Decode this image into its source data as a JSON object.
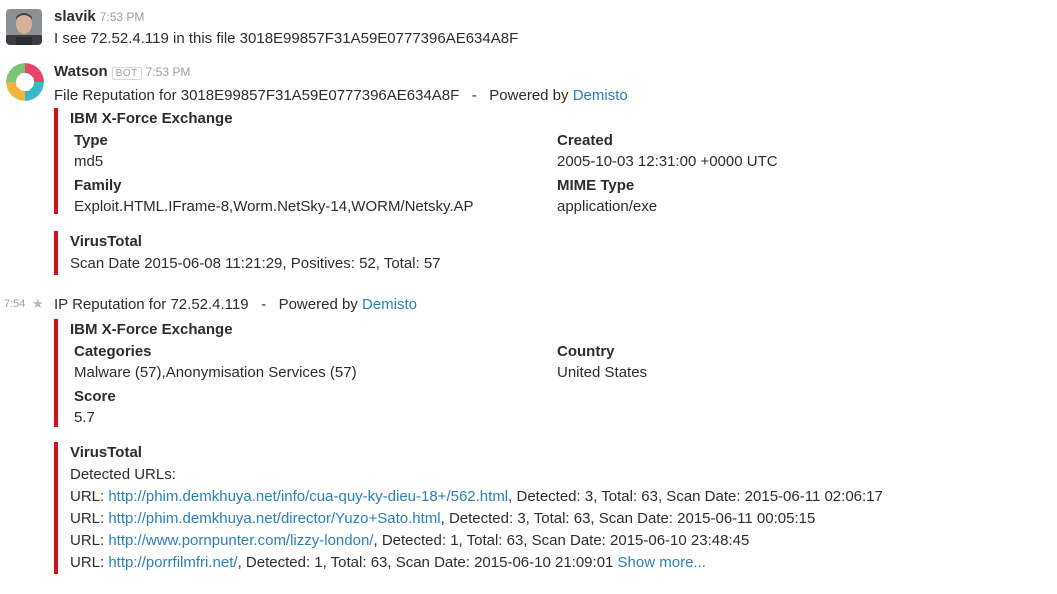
{
  "message1": {
    "username": "slavik",
    "time": "7:53 PM",
    "text": "I see 72.52.4.119 in this file 3018E99857F31A59E0777396AE634A8F"
  },
  "message2": {
    "username": "Watson",
    "bot_badge": "BOT",
    "time": "7:53 PM",
    "header_text": "File Reputation for 3018E99857F31A59E0777396AE634A8F   -   Powered by ",
    "powered_link": "Demisto",
    "xforce": {
      "title": "IBM X-Force Exchange",
      "type_label": "Type",
      "type_value": "md5",
      "created_label": "Created",
      "created_value": "2005-10-03 12:31:00 +0000 UTC",
      "family_label": "Family",
      "family_value": "Exploit.HTML.IFrame-8,Worm.NetSky-14,WORM/Netsky.AP",
      "mime_label": "MIME Type",
      "mime_value": "application/exe"
    },
    "virustotal": {
      "title": "VirusTotal",
      "summary": "Scan Date 2015-06-08 11:21:29, Positives: 52, Total: 57"
    }
  },
  "message3": {
    "hover_time": "7:54",
    "header_text": "IP Reputation for 72.52.4.119   -   Powered by ",
    "powered_link": "Demisto",
    "xforce": {
      "title": "IBM X-Force Exchange",
      "categories_label": "Categories",
      "categories_value": "Malware (57),Anonymisation Services (57)",
      "country_label": "Country",
      "country_value": "United States",
      "score_label": "Score",
      "score_value": "5.7"
    },
    "virustotal": {
      "title": "VirusTotal",
      "detected_label": "Detected URLs:",
      "urls": [
        {
          "prefix": "URL: ",
          "url": "http://phim.demkhuya.net/info/cua-quy-ky-dieu-18+/562.html",
          "suffix": ", Detected: 3, Total: 63, Scan Date: 2015-06-11 02:06:17"
        },
        {
          "prefix": "URL: ",
          "url": "http://phim.demkhuya.net/director/Yuzo+Sato.html",
          "suffix": ", Detected: 3, Total: 63, Scan Date: 2015-06-11 00:05:15"
        },
        {
          "prefix": "URL: ",
          "url": "http://www.pornpunter.com/lizzy-london/",
          "suffix": ", Detected: 1, Total: 63, Scan Date: 2015-06-10 23:48:45"
        },
        {
          "prefix": "URL: ",
          "url": "http://porrfilmfri.net/",
          "suffix": ", Detected: 1, Total: 63, Scan Date: 2015-06-10 21:09:01 "
        }
      ],
      "show_more": "Show more..."
    }
  },
  "colors": {
    "attachment_bar": "#d20f1c",
    "link": "#2a80b9"
  }
}
